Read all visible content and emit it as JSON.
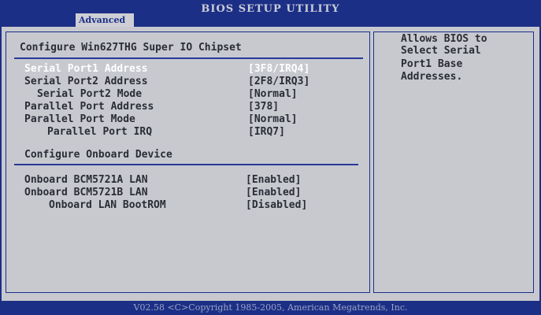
{
  "app": {
    "title": "BIOS SETUP UTILITY",
    "active_tab": "Advanced"
  },
  "main": {
    "section_heading": "Configure Win627THG Super IO Chipset",
    "items": [
      {
        "label": "Serial Port1 Address",
        "value": "[3F8/IRQ4]",
        "selected": true
      },
      {
        "label": "Serial Port2 Address",
        "value": "[2F8/IRQ3]"
      },
      {
        "label": "Serial Port2 Mode",
        "value": "[Normal]"
      },
      {
        "label": "Parallel Port Address",
        "value": "[378]"
      },
      {
        "label": "Parallel Port Mode",
        "value": "[Normal]"
      },
      {
        "label": "Parallel Port IRQ",
        "value": "[IRQ7]"
      }
    ],
    "onboard_heading": "Configure Onboard Device",
    "onboard_items": [
      {
        "label": "Onboard BCM5721A LAN",
        "value": "[Enabled]"
      },
      {
        "label": "Onboard BCM5721B LAN",
        "value": "[Enabled]"
      },
      {
        "label": "Onboard LAN BootROM",
        "value": "[Disabled]"
      }
    ]
  },
  "help": {
    "lines": [
      "Allows BIOS to",
      "Select Serial",
      "Port1 Base",
      "Addresses."
    ]
  },
  "footer": {
    "text": "V02.58 <C>Copyright 1985-2005, American Megatrends, Inc."
  },
  "colors": {
    "frame_blue": "#1c2f86",
    "panel_gray": "#c7c9cf",
    "text_dark": "#2a2d35",
    "selected_text": "#ffffff"
  }
}
